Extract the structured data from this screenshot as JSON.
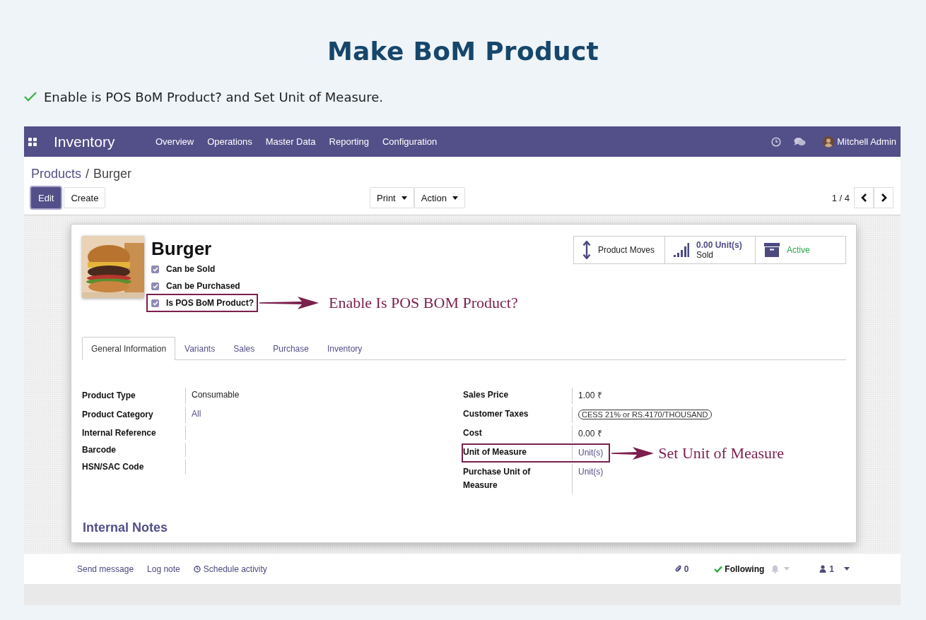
{
  "page_title": "Make BoM Product",
  "instruction": "Enable is POS BoM Product? and Set Unit of Measure.",
  "navbar": {
    "app_name": "Inventory",
    "menu": [
      "Overview",
      "Operations",
      "Master Data",
      "Reporting",
      "Configuration"
    ],
    "user": "Mitchell Admin"
  },
  "breadcrumb": [
    "Products",
    "Burger"
  ],
  "breadcrumb_separator": "/",
  "actions": [
    {
      "label": "Edit",
      "kind": "primary"
    },
    {
      "label": "Create",
      "kind": "secondary"
    }
  ],
  "dropdowns": [
    "Print",
    "Action"
  ],
  "pager": "1 / 4",
  "product": {
    "name": "Burger",
    "options": [
      {
        "label": "Can be Sold",
        "checked": true,
        "highlighted": false
      },
      {
        "label": "Can be Purchased",
        "checked": true,
        "highlighted": false
      },
      {
        "label": "Is POS BoM Product?",
        "checked": true,
        "highlighted": true,
        "annotation": "Enable Is POS BOM Product?"
      }
    ],
    "smart_buttons": [
      {
        "kind": "moves",
        "label": "Product Moves"
      },
      {
        "kind": "sold",
        "value": "0.00 Unit(s)",
        "label": "Sold"
      },
      {
        "kind": "active",
        "label": "Active"
      }
    ]
  },
  "tabs": [
    {
      "label": "General Information",
      "selected": true
    },
    {
      "label": "Variants",
      "selected": false
    },
    {
      "label": "Sales",
      "selected": false
    },
    {
      "label": "Purchase",
      "selected": false
    },
    {
      "label": "Inventory",
      "selected": false
    }
  ],
  "left_fields": [
    {
      "label": "Product Type",
      "value": "Consumable",
      "kind": "text"
    },
    {
      "label": "Product Category",
      "value": "All",
      "kind": "link"
    },
    {
      "label": "Internal Reference"
    },
    {
      "label": "Barcode"
    },
    {
      "label": "HSN/SAC Code"
    }
  ],
  "right_fields": [
    {
      "label": "Sales Price",
      "value": "1.00 ₹",
      "kind": "text",
      "highlighted": false
    },
    {
      "label": "Customer Taxes",
      "value": "CESS 21% or RS.4170/THOUSAND",
      "kind": "tag",
      "highlighted": false
    },
    {
      "label": "Cost",
      "value": "0.00 ₹",
      "kind": "text",
      "highlighted": false
    },
    {
      "label": "Unit of Measure",
      "value": "Unit(s)",
      "kind": "link",
      "highlighted": true,
      "annotation": "Set Unit of Measure"
    },
    {
      "label": "Purchase Unit of Measure",
      "value": "Unit(s)",
      "kind": "link",
      "highlighted": false
    }
  ],
  "notes_heading": "Internal Notes",
  "chatter": {
    "actions": [
      "Send message",
      "Log note",
      "Schedule activity"
    ],
    "attachments": "0",
    "follow": "Following",
    "followers": "1"
  }
}
